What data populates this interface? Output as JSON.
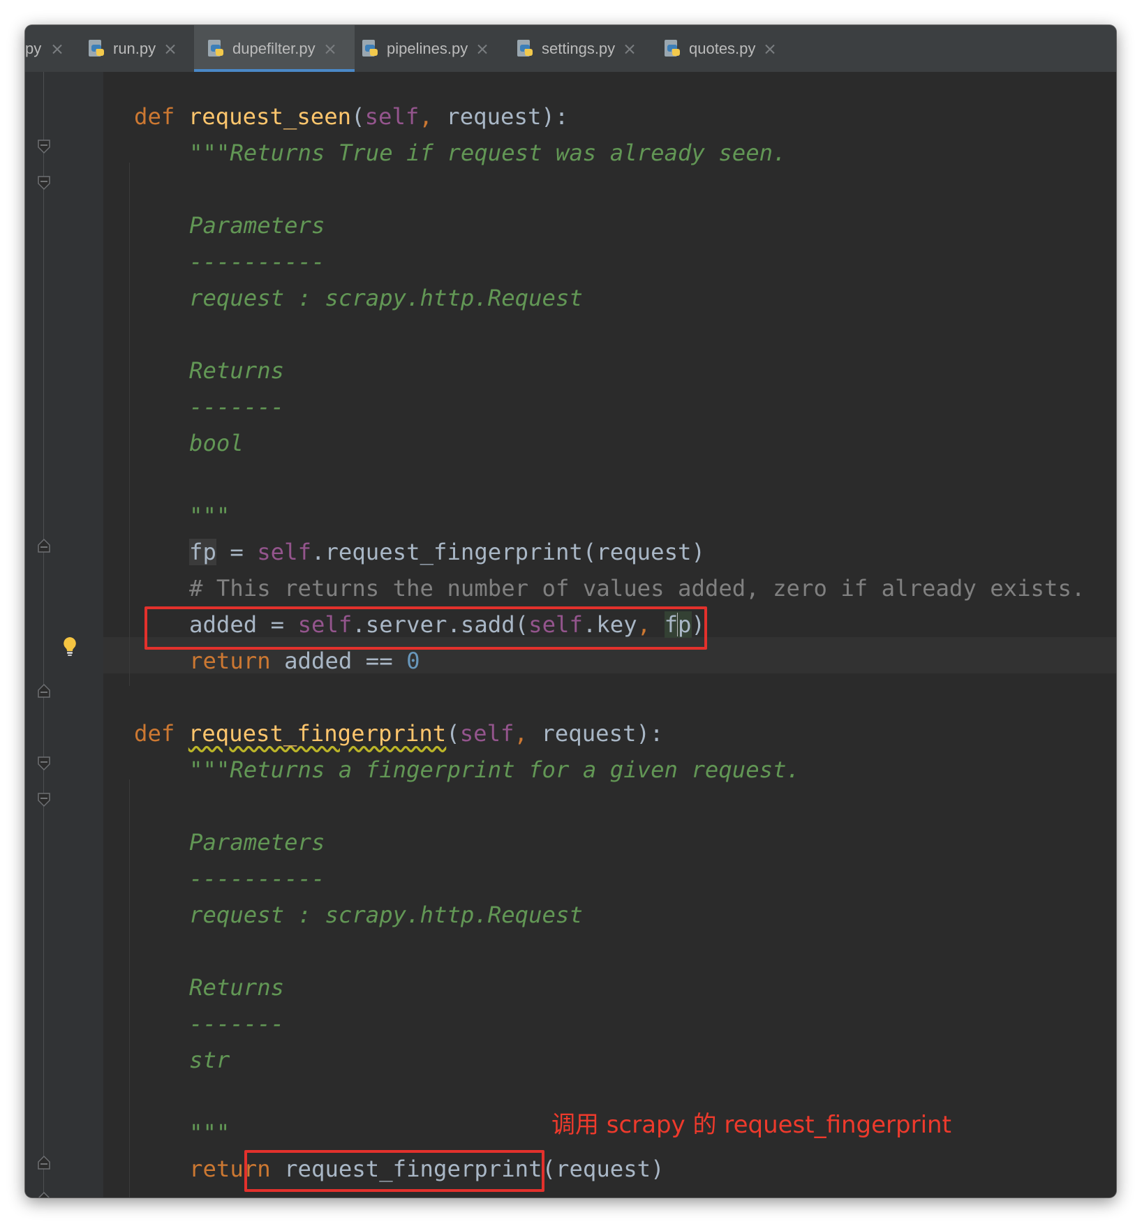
{
  "tabs": [
    {
      "label": "py",
      "active": false
    },
    {
      "label": "run.py",
      "active": false
    },
    {
      "label": "dupefilter.py",
      "active": true
    },
    {
      "label": "pipelines.py",
      "active": false
    },
    {
      "label": "settings.py",
      "active": false
    },
    {
      "label": "quotes.py",
      "active": false
    }
  ],
  "code": {
    "l1_def": "def",
    "l1_name": "request_seen",
    "l1_open": "(",
    "l1_self": "self",
    "l1_comma": ",",
    "l1_rest": " request):",
    "l2": "\"\"\"Returns True if request was already seen.",
    "l4": "Parameters",
    "l5": "----------",
    "l6": "request : scrapy.http.Request",
    "l8": "Returns",
    "l9": "-------",
    "l10": "bool",
    "l12": "\"\"\"",
    "l13_fp": "fp",
    "l13_eq": " = ",
    "l13_self": "self",
    "l13_rest": ".request_fingerprint(request)",
    "l14": "# This returns the number of values added, zero if already exists.",
    "l15_a": "added = ",
    "l15_self1": "self",
    "l15_b": ".server.sadd(",
    "l15_self2": "self",
    "l15_c": ".key",
    "l15_comma": ",",
    "l15_sp": " ",
    "l15_f": "f",
    "l15_p": "p",
    "l15_close": ")",
    "l16_ret": "return",
    "l16_rest": " added == ",
    "l16_num": "0",
    "l18_def": "def",
    "l18_name": "request_fingerprint",
    "l18_open": "(",
    "l18_self": "self",
    "l18_comma": ",",
    "l18_rest": " request):",
    "l19": "\"\"\"Returns a fingerprint for a given request.",
    "l21": "Parameters",
    "l22": "----------",
    "l23": "request : scrapy.http.Request",
    "l25": "Returns",
    "l26": "-------",
    "l27": "str",
    "l29": "\"\"\"",
    "l30_ret": "return",
    "l30_rest": " request_fingerprint(request)"
  },
  "annotation": {
    "text": "调用 scrapy 的 request_fingerprint",
    "color": "#ee3a2c"
  },
  "colors": {
    "keyword": "#cc7832",
    "function": "#ffc66d",
    "self": "#94558d",
    "docstring": "#629755",
    "comment": "#808080",
    "number": "#6897bb",
    "text": "#a9b7c6",
    "background": "#2b2b2b",
    "tab_active_underline": "#4a88c7"
  },
  "icons": [
    "python-file-icon",
    "close-icon",
    "fold-marker-icon",
    "lightbulb-icon"
  ]
}
